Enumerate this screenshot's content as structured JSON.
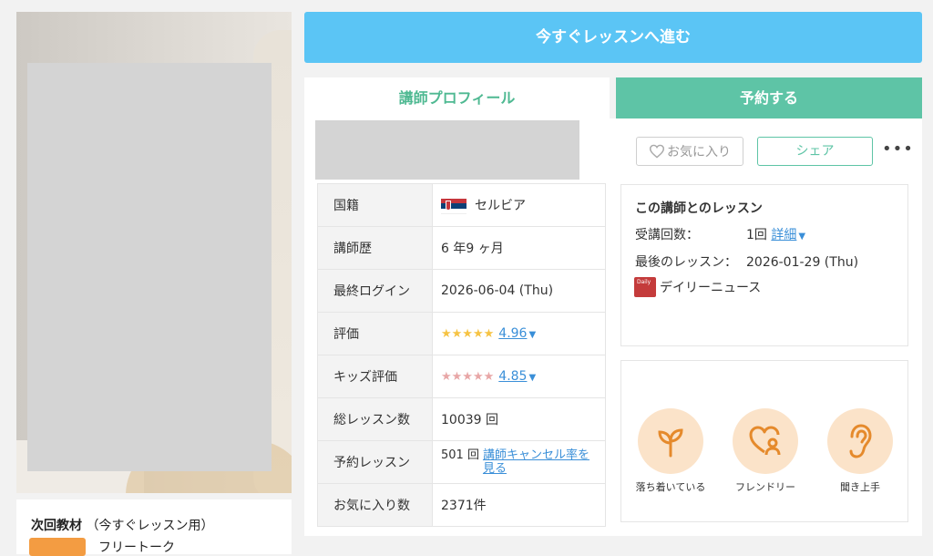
{
  "colors": {
    "accent_blue": "#5bc5f5",
    "accent_green": "#5ec4a6",
    "link": "#3a8fd8",
    "star_gold": "#f6c343",
    "star_pink": "#e8a7a7"
  },
  "top_button": {
    "label": "今すぐレッスンへ進む"
  },
  "tabs": {
    "profile": "講師プロフィール",
    "reserve": "予約する"
  },
  "actions": {
    "favorite": "お気に入り",
    "share": "シェア",
    "more": "•••"
  },
  "material": {
    "title": "次回教材",
    "subtitle": "（今すぐレッスン用）",
    "name": "フリートーク"
  },
  "profile_table": {
    "nationality": {
      "label": "国籍",
      "value": "セルビア",
      "icon": "serbia-flag-icon"
    },
    "experience": {
      "label": "講師歴",
      "value": "6 年9 ヶ月"
    },
    "last_login": {
      "label": "最終ログイン",
      "value": "2026-06-04 (Thu)"
    },
    "rating": {
      "label": "評価",
      "stars": "★★★★★",
      "value": "4.96"
    },
    "kids_rating": {
      "label": "キッズ評価",
      "stars": "★★★★★",
      "value": "4.85"
    },
    "total_lessons": {
      "label": "総レッスン数",
      "value": "10039 回"
    },
    "reserved": {
      "label": "予約レッスン",
      "count": "501 回",
      "link": "講師キャンセル率を見る"
    },
    "favorites": {
      "label": "お気に入り数",
      "value": "2371件"
    }
  },
  "history": {
    "title": "この講師とのレッスン",
    "count_label": "受講回数：",
    "count_value": "1回",
    "detail_link": "詳細",
    "last_label": "最後のレッスン：",
    "last_value": "2026-01-29 (Thu)",
    "book_icon": "daily-news-book-icon",
    "material_name": "デイリーニュース"
  },
  "features": [
    {
      "label": "落ち着いている",
      "icon": "sprout-icon"
    },
    {
      "label": "フレンドリー",
      "icon": "heart-person-icon"
    },
    {
      "label": "聞き上手",
      "icon": "ear-icon"
    }
  ]
}
